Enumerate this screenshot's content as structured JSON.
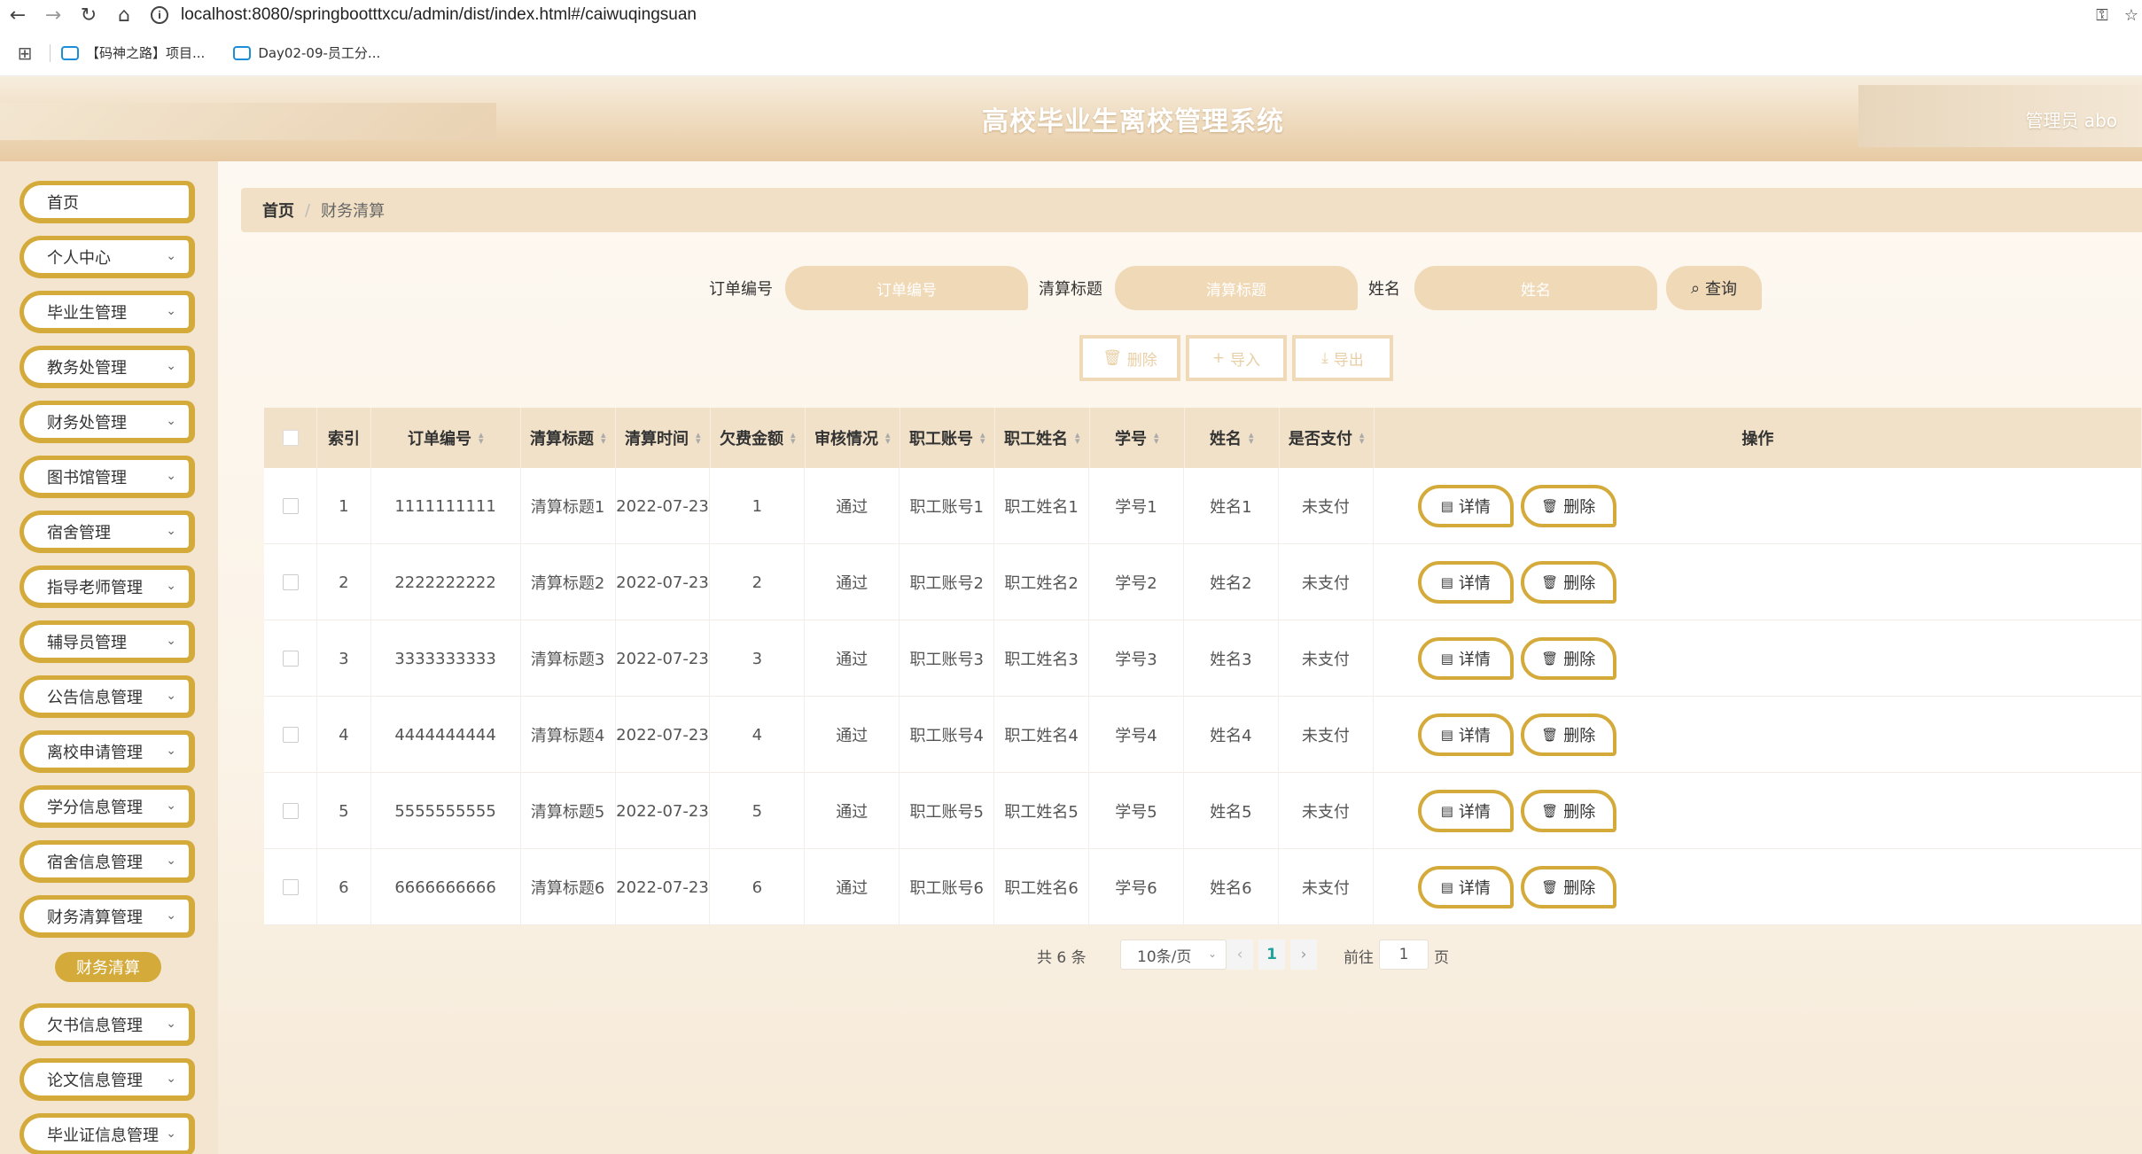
{
  "browser": {
    "url": "localhost:8080/springbootttxcu/admin/dist/index.html#/caiwuqingsuan",
    "bookmarks": [
      "【码神之路】项目...",
      "Day02-09-员工分..."
    ]
  },
  "header": {
    "title": "高校毕业生离校管理系统",
    "user": "管理员 abo"
  },
  "sidebar": {
    "items": [
      {
        "label": "首页",
        "has_arrow": false
      },
      {
        "label": "个人中心",
        "has_arrow": true
      },
      {
        "label": "毕业生管理",
        "has_arrow": true
      },
      {
        "label": "教务处管理",
        "has_arrow": true
      },
      {
        "label": "财务处管理",
        "has_arrow": true
      },
      {
        "label": "图书馆管理",
        "has_arrow": true
      },
      {
        "label": "宿舍管理",
        "has_arrow": true
      },
      {
        "label": "指导老师管理",
        "has_arrow": true
      },
      {
        "label": "辅导员管理",
        "has_arrow": true
      },
      {
        "label": "公告信息管理",
        "has_arrow": true
      },
      {
        "label": "离校申请管理",
        "has_arrow": true
      },
      {
        "label": "学分信息管理",
        "has_arrow": true
      },
      {
        "label": "宿舍信息管理",
        "has_arrow": true
      },
      {
        "label": "财务清算管理",
        "has_arrow": true
      },
      {
        "label": "欠书信息管理",
        "has_arrow": true
      },
      {
        "label": "论文信息管理",
        "has_arrow": true
      },
      {
        "label": "毕业证信息管理",
        "has_arrow": true
      }
    ],
    "active_sub": "财务清算"
  },
  "breadcrumb": {
    "home": "首页",
    "current": "财务清算"
  },
  "search": {
    "order_label": "订单编号",
    "order_placeholder": "订单编号",
    "title_label": "清算标题",
    "title_placeholder": "清算标题",
    "name_label": "姓名",
    "name_placeholder": "姓名",
    "query_button": "查询"
  },
  "actions": {
    "delete": "删除",
    "import": "导入",
    "export": "导出"
  },
  "table": {
    "columns": [
      "索引",
      "订单编号",
      "清算标题",
      "清算时间",
      "欠费金额",
      "审核情况",
      "职工账号",
      "职工姓名",
      "学号",
      "姓名",
      "是否支付",
      "操作"
    ],
    "rows": [
      {
        "index": "1",
        "order": "1111111111",
        "title": "清算标题1",
        "time": "2022-07-23",
        "amount": "1",
        "audit": "通过",
        "staff_acct": "职工账号1",
        "staff_name": "职工姓名1",
        "stu_no": "学号1",
        "name": "姓名1",
        "paid": "未支付"
      },
      {
        "index": "2",
        "order": "2222222222",
        "title": "清算标题2",
        "time": "2022-07-23",
        "amount": "2",
        "audit": "通过",
        "staff_acct": "职工账号2",
        "staff_name": "职工姓名2",
        "stu_no": "学号2",
        "name": "姓名2",
        "paid": "未支付"
      },
      {
        "index": "3",
        "order": "3333333333",
        "title": "清算标题3",
        "time": "2022-07-23",
        "amount": "3",
        "audit": "通过",
        "staff_acct": "职工账号3",
        "staff_name": "职工姓名3",
        "stu_no": "学号3",
        "name": "姓名3",
        "paid": "未支付"
      },
      {
        "index": "4",
        "order": "4444444444",
        "title": "清算标题4",
        "time": "2022-07-23",
        "amount": "4",
        "audit": "通过",
        "staff_acct": "职工账号4",
        "staff_name": "职工姓名4",
        "stu_no": "学号4",
        "name": "姓名4",
        "paid": "未支付"
      },
      {
        "index": "5",
        "order": "5555555555",
        "title": "清算标题5",
        "time": "2022-07-23",
        "amount": "5",
        "audit": "通过",
        "staff_acct": "职工账号5",
        "staff_name": "职工姓名5",
        "stu_no": "学号5",
        "name": "姓名5",
        "paid": "未支付"
      },
      {
        "index": "6",
        "order": "6666666666",
        "title": "清算标题6",
        "time": "2022-07-23",
        "amount": "6",
        "audit": "通过",
        "staff_acct": "职工账号6",
        "staff_name": "职工姓名6",
        "stu_no": "学号6",
        "name": "姓名6",
        "paid": "未支付"
      }
    ],
    "row_actions": {
      "detail": "详情",
      "delete": "删除"
    }
  },
  "pagination": {
    "total": "共 6 条",
    "page_size": "10条/页",
    "current_page": "1",
    "goto_label": "前往",
    "goto_value": "1",
    "page_suffix": "页"
  },
  "colors": {
    "accent": "#d4aa3a",
    "header_bg": "#f1e1c8",
    "input_bg": "#f0d9b7",
    "active_page": "#1fa39a"
  }
}
